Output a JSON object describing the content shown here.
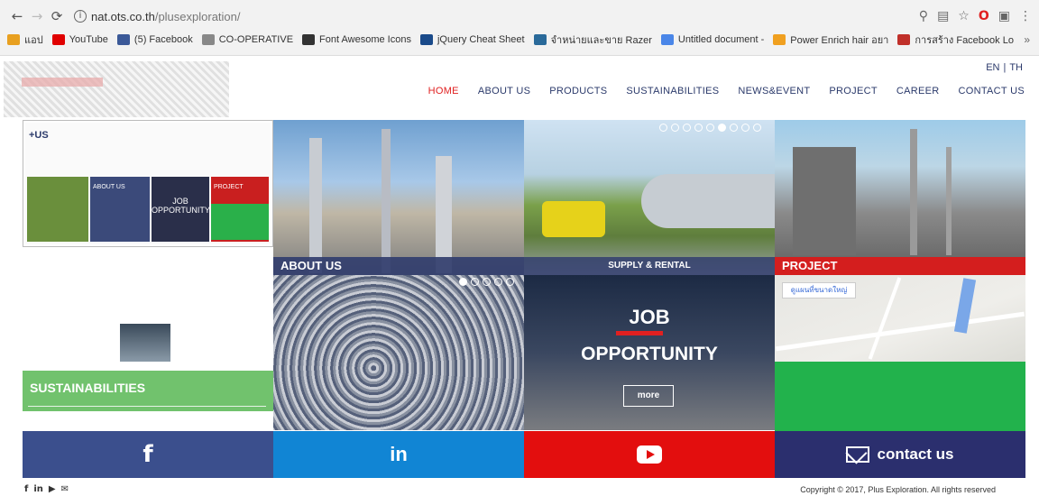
{
  "browser": {
    "url_host": "nat.ots.co.th",
    "url_path": "/plusexploration/",
    "bookmarks": [
      {
        "label": "แอป",
        "icon": "apps-grid-icon",
        "color": "#e8a020"
      },
      {
        "label": "YouTube",
        "icon": "youtube-icon",
        "color": "#e00000"
      },
      {
        "label": "(5) Facebook",
        "icon": "facebook-icon",
        "color": "#3b5998"
      },
      {
        "label": "CO-OPERATIVE",
        "icon": "page-icon",
        "color": "#888888"
      },
      {
        "label": "Font Awesome Icons",
        "icon": "flag-icon",
        "color": "#333333"
      },
      {
        "label": "jQuery Cheat Sheet",
        "icon": "users-icon",
        "color": "#1a4a8a"
      },
      {
        "label": "จำหน่ายและขาย Razer",
        "icon": "globe-icon",
        "color": "#2a6a9a"
      },
      {
        "label": "Untitled document -",
        "icon": "docs-icon",
        "color": "#4a86e8"
      },
      {
        "label": "Power Enrich hair อยา",
        "icon": "circle-icon",
        "color": "#f0a020"
      },
      {
        "label": "การสร้าง Facebook Lo",
        "icon": "image-icon",
        "color": "#c0302a"
      }
    ],
    "more_label": "»"
  },
  "header": {
    "lang_en": "EN",
    "lang_th": "TH",
    "menu": [
      {
        "label": "HOME",
        "active": true
      },
      {
        "label": "ABOUT US",
        "active": false
      },
      {
        "label": "PRODUCTS",
        "active": false
      },
      {
        "label": "SUSTAINABILITIES",
        "active": false
      },
      {
        "label": "NEWS&EVENT",
        "active": false
      },
      {
        "label": "PROJECT",
        "active": false
      },
      {
        "label": "CAREER",
        "active": false
      },
      {
        "label": "CONTACT US",
        "active": false
      }
    ]
  },
  "tiles": {
    "about_caption": "ABOUT US",
    "supply_caption": "SUPPLY & RENTAL",
    "project_caption": "PROJECT",
    "job_title_1": "JOB",
    "job_title_2": "OPPORTUNITY",
    "job_more": "more",
    "map_button": "ดูแผนที่ขนาดใหญ่",
    "sustainabilities_caption": "SUSTAINABILITIES",
    "mini_job_1": "JOB",
    "mini_job_2": "OPPORTUNITY",
    "mini_about": "ABOUT US",
    "mini_project": "PROJECT"
  },
  "social": {
    "facebook": "f",
    "linkedin": "in",
    "contact": "contact us"
  },
  "footer": {
    "icons": [
      "f",
      "in",
      "▶",
      "✉"
    ],
    "copyright": "Copyright © 2017, Plus Exploration. All rights reserved"
  },
  "colors": {
    "nav_text": "#2b3a6b",
    "active": "#e02020",
    "facebook": "#3b4f8d",
    "linkedin": "#1185d4",
    "youtube": "#e30e0e",
    "contact": "#2b2f6e",
    "sustainabilities": "#71c26d",
    "project": "#d41e1e"
  }
}
